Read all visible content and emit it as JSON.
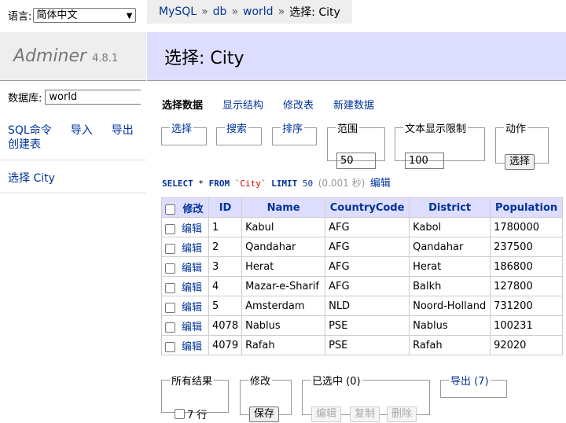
{
  "menu": {
    "language_label": "语言:",
    "language_value": "简体中文",
    "app_name": "Adminer",
    "version": "4.8.1",
    "db_label": "数据库:",
    "db_value": "world",
    "sql_command": "SQL命令",
    "import": "导入",
    "export": "导出",
    "create_table": "创建表",
    "table_link": "选择 City"
  },
  "breadcrumb": {
    "item1": "MySQL",
    "sep": "»",
    "item2": "db",
    "item3": "world",
    "current": "选择: City"
  },
  "page_title": "选择: City",
  "tabs": {
    "select_data": "选择数据",
    "show_structure": "显示结构",
    "alter_table": "修改表",
    "new_item": "新建数据"
  },
  "filters": {
    "select": "选择",
    "search": "搜索",
    "sort": "排序",
    "limit_label": "范围",
    "limit_value": "50",
    "text_length_label": "文本显示限制",
    "text_length_value": "100",
    "action_label": "动作",
    "action_button": "选择"
  },
  "query": {
    "select_kw": "SELECT",
    "star": "*",
    "from_kw": "FROM",
    "table": "`City`",
    "limit_kw": "LIMIT",
    "limit_num": "50",
    "time": "(0.001 秒)",
    "edit": "编辑"
  },
  "table": {
    "headers": {
      "modify": "修改",
      "id": "ID",
      "name": "Name",
      "country_code": "CountryCode",
      "district": "District",
      "population": "Population"
    },
    "edit_label": "编辑",
    "rows": [
      {
        "id": "1",
        "name": "Kabul",
        "country_code": "AFG",
        "district": "Kabol",
        "population": "1780000"
      },
      {
        "id": "2",
        "name": "Qandahar",
        "country_code": "AFG",
        "district": "Qandahar",
        "population": "237500"
      },
      {
        "id": "3",
        "name": "Herat",
        "country_code": "AFG",
        "district": "Herat",
        "population": "186800"
      },
      {
        "id": "4",
        "name": "Mazar-e-Sharif",
        "country_code": "AFG",
        "district": "Balkh",
        "population": "127800"
      },
      {
        "id": "5",
        "name": "Amsterdam",
        "country_code": "NLD",
        "district": "Noord-Holland",
        "population": "731200"
      },
      {
        "id": "4078",
        "name": "Nablus",
        "country_code": "PSE",
        "district": "Nablus",
        "population": "100231"
      },
      {
        "id": "4079",
        "name": "Rafah",
        "country_code": "PSE",
        "district": "Rafah",
        "population": "92020"
      }
    ]
  },
  "footer": {
    "all_results_label": "所有结果",
    "rows_count": "7 行",
    "modify_label": "修改",
    "save": "保存",
    "selected_label": "已选中 (0)",
    "edit": "编辑",
    "clone": "复制",
    "delete": "删除",
    "export_label": "导出 (7)"
  }
}
